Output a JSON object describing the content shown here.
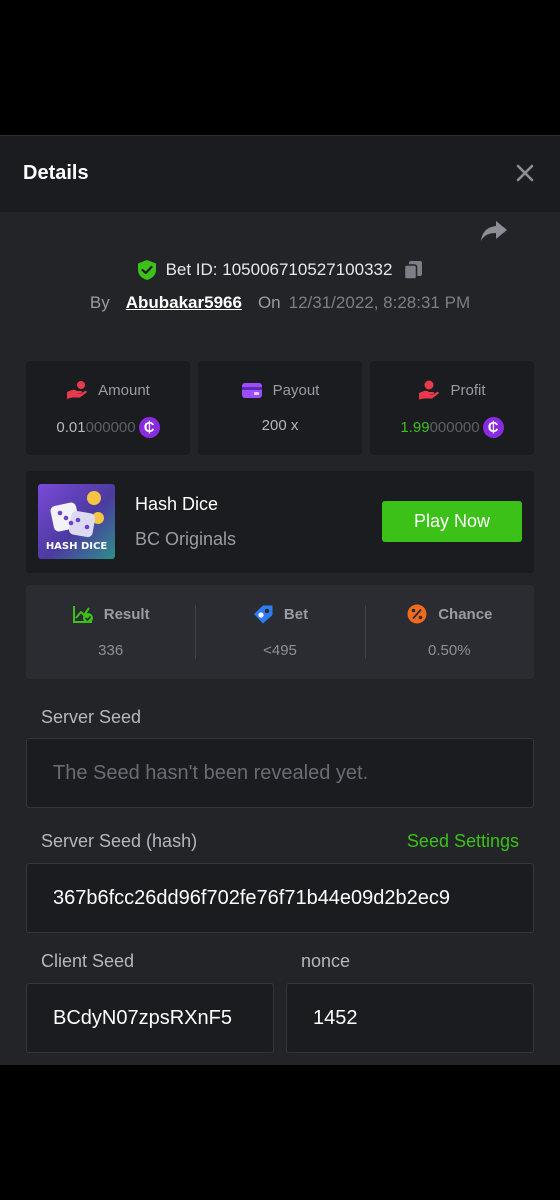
{
  "header": {
    "title": "Details"
  },
  "bet": {
    "id_label": "Bet ID: 105006710527100332",
    "by_label": "By",
    "username": "Abubakar5966",
    "on_label": "On",
    "date": "12/31/2022, 8:28:31 PM"
  },
  "stats": {
    "amount": {
      "label": "Amount",
      "value_main": "0.01",
      "value_dim": "000000",
      "icon": "hand-coins-icon"
    },
    "payout": {
      "label": "Payout",
      "value": "200 x",
      "icon": "wallet-icon"
    },
    "profit": {
      "label": "Profit",
      "value_main": "1.99",
      "value_dim": "000000",
      "icon": "hand-heart-icon"
    },
    "coin_symbol": "₵"
  },
  "game": {
    "thumb_label": "HASH DICE",
    "name": "Hash Dice",
    "provider": "BC Originals",
    "play_label": "Play Now"
  },
  "result": {
    "result_label": "Result",
    "result_value": "336",
    "bet_label": "Bet",
    "bet_value": "<495",
    "chance_label": "Chance",
    "chance_value": "0.50%"
  },
  "seeds": {
    "server_seed_label": "Server Seed",
    "server_seed_value": "The Seed hasn't been revealed yet.",
    "server_hash_label": "Server Seed (hash)",
    "seed_settings_label": "Seed Settings",
    "server_hash_value": "367b6fcc26dd96f702fe76f71b44e09d2b2ec9",
    "client_seed_label": "Client Seed",
    "client_seed_value": "BCdyN07zpsRXnF5",
    "nonce_label": "nonce",
    "nonce_value": "1452"
  },
  "colors": {
    "accent_green": "#3bc117",
    "panel": "#1b1c1f",
    "background": "#232428"
  }
}
